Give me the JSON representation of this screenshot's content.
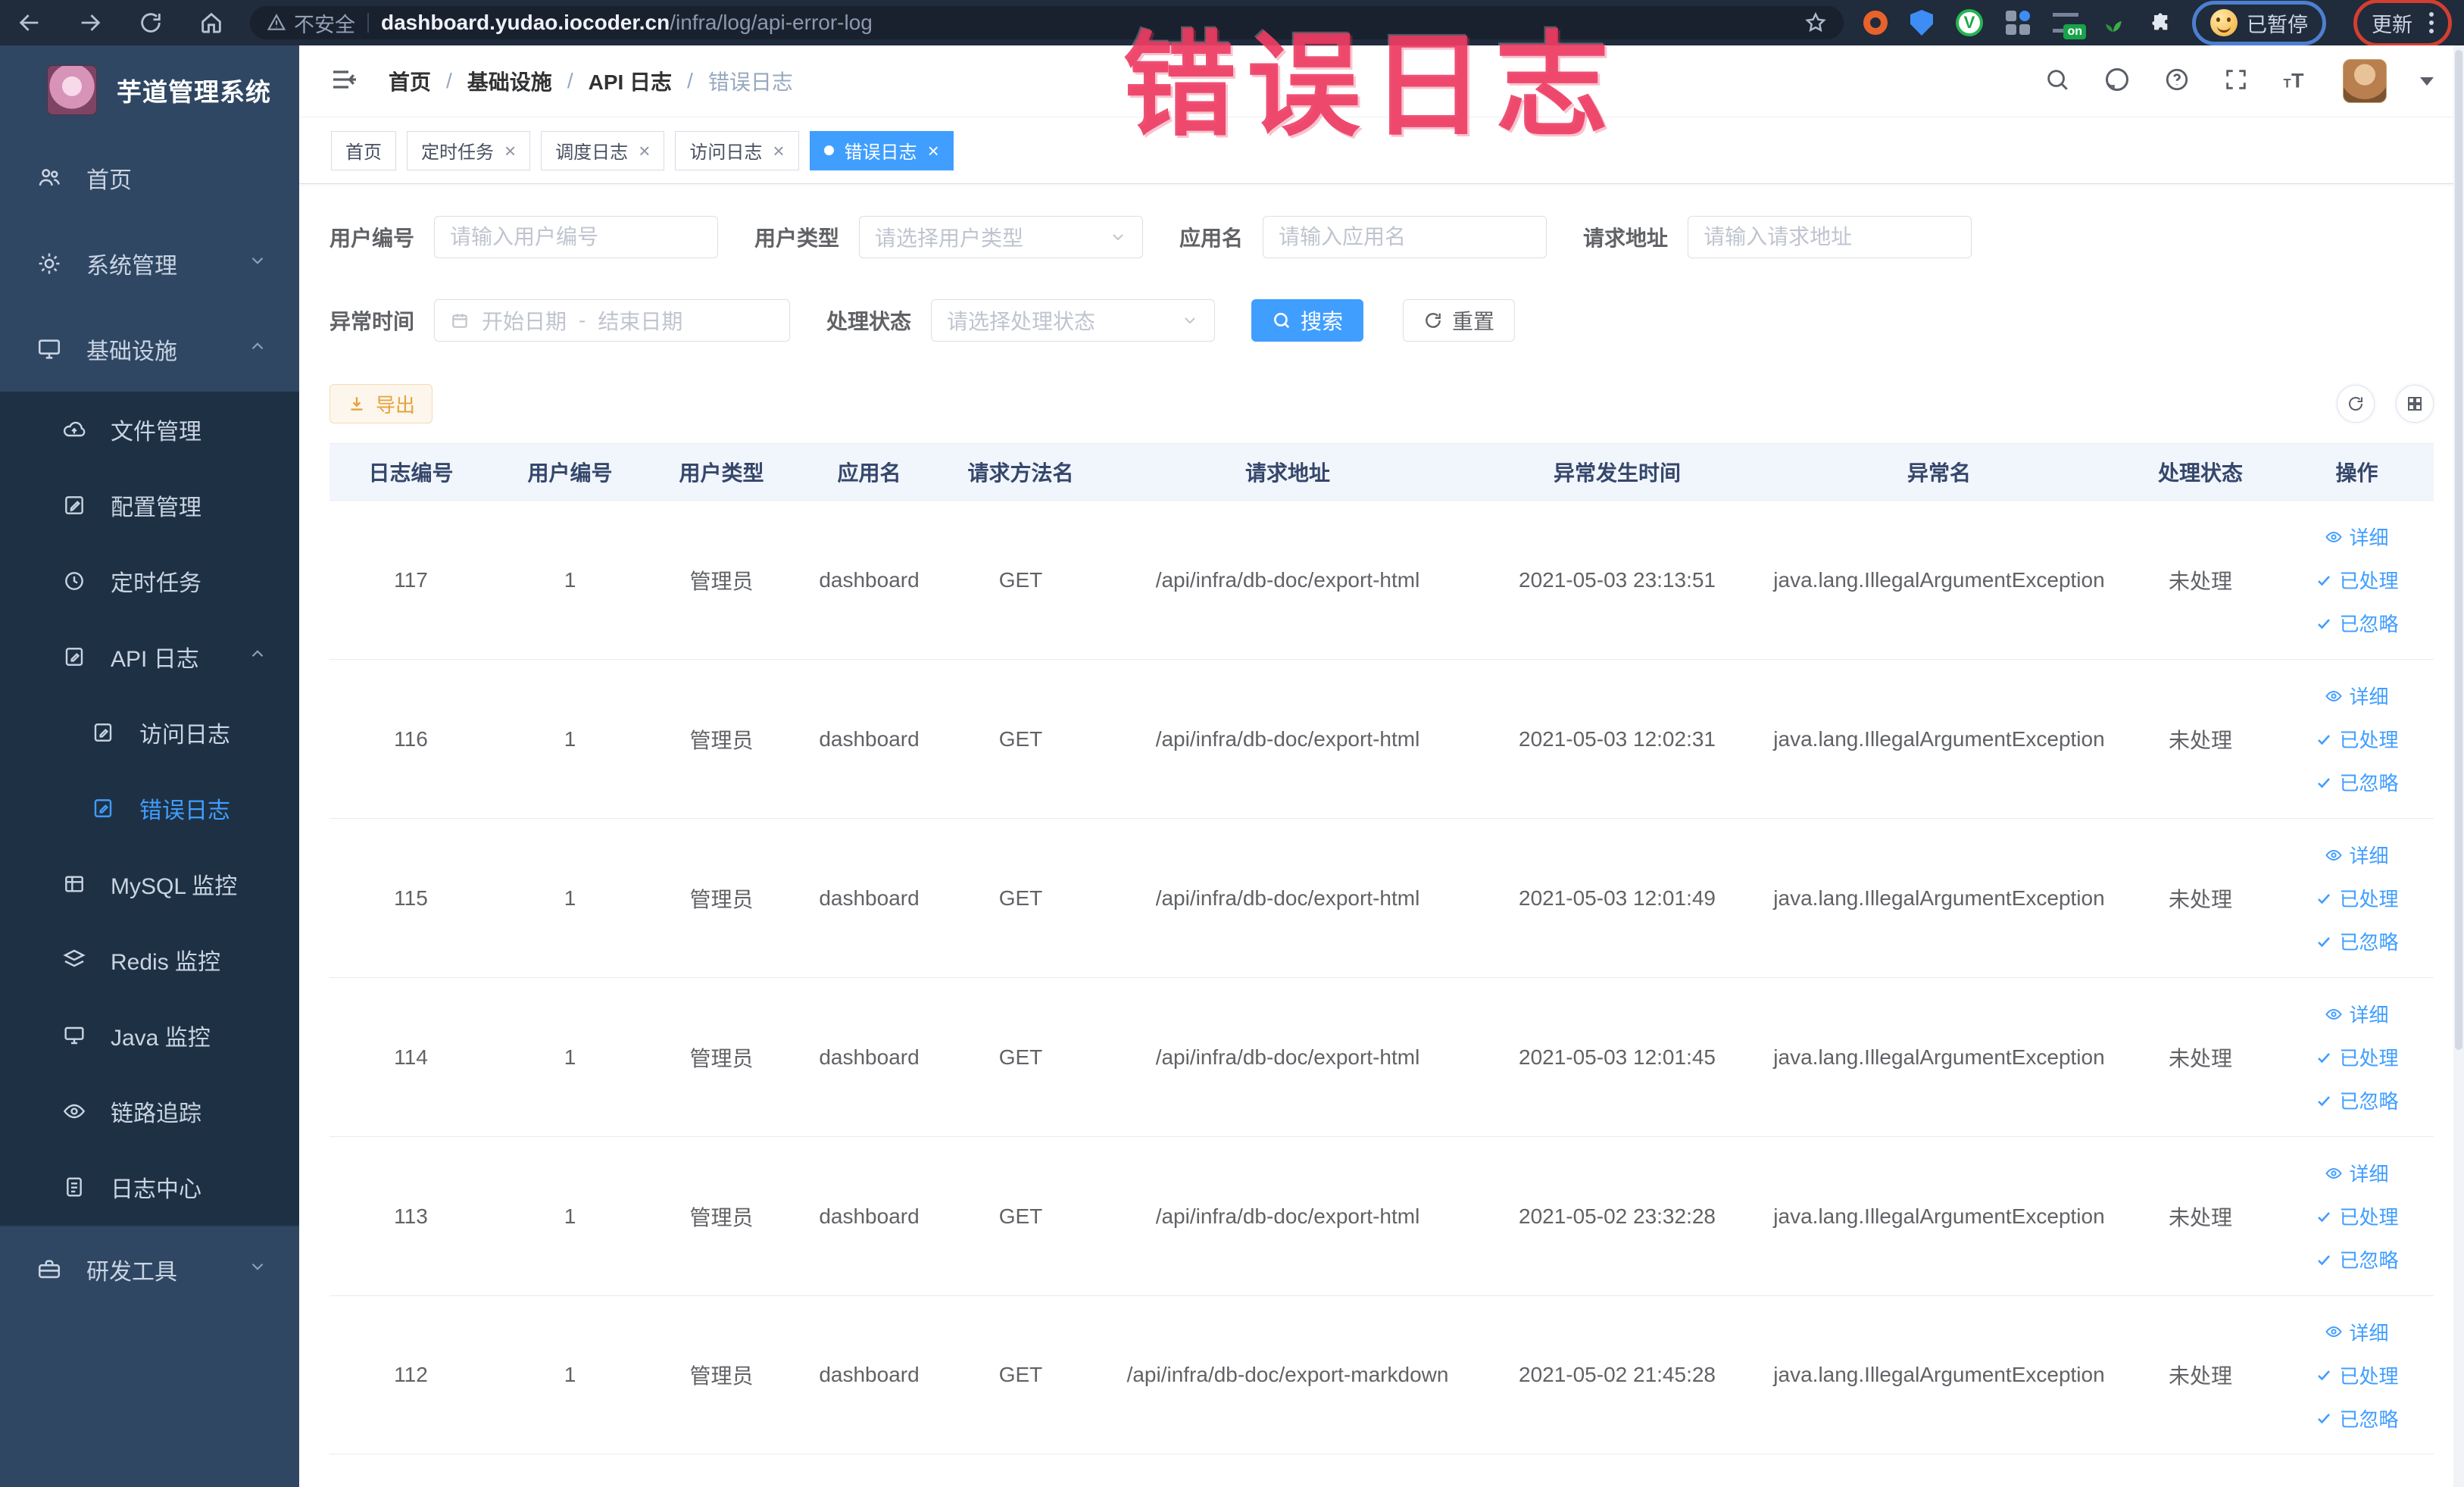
{
  "colors": {
    "primary": "#409eff",
    "warning": "#e6a23c",
    "annotation_pink": "#ec3860",
    "annotation_blue": "#4d7fd0",
    "annotation_red": "#d23f31",
    "sidebar_bg": "#2f4763",
    "submenu_bg": "#1e3144",
    "chrome_bg": "#202b3b"
  },
  "browser": {
    "security_label": "不安全",
    "url_host": "dashboard.yudao.iocoder.cn",
    "url_path": "/infra/log/api-error-log",
    "ext_v_label": "V",
    "on_badge": "on",
    "paused_chip": "已暂停",
    "update_label": "更新"
  },
  "annotation": {
    "title": "错误日志"
  },
  "sidebar": {
    "title": "芋道管理系统",
    "home": "首页",
    "system": "系统管理",
    "infra": "基础设施",
    "file": "文件管理",
    "config": "配置管理",
    "job": "定时任务",
    "api_log": "API 日志",
    "access_log": "访问日志",
    "error_log": "错误日志",
    "mysql": "MySQL 监控",
    "redis": "Redis 监控",
    "java": "Java 监控",
    "trace": "链路追踪",
    "log_center": "日志中心",
    "devtools": "研发工具"
  },
  "breadcrumb": {
    "items": [
      "首页",
      "基础设施",
      "API 日志",
      "错误日志"
    ],
    "separator": "/"
  },
  "tabs": [
    {
      "label": "首页"
    },
    {
      "label": "定时任务"
    },
    {
      "label": "调度日志"
    },
    {
      "label": "访问日志"
    },
    {
      "label": "错误日志"
    }
  ],
  "filters": {
    "user_id": {
      "label": "用户编号",
      "placeholder": "请输入用户编号"
    },
    "user_type": {
      "label": "用户类型",
      "placeholder": "请选择用户类型"
    },
    "app_name": {
      "label": "应用名",
      "placeholder": "请输入应用名"
    },
    "request_url": {
      "label": "请求地址",
      "placeholder": "请输入请求地址"
    },
    "exception_time": {
      "label": "异常时间",
      "start_placeholder": "开始日期",
      "separator": "-",
      "end_placeholder": "结束日期"
    },
    "process_status": {
      "label": "处理状态",
      "placeholder": "请选择处理状态"
    },
    "search": "搜索",
    "reset": "重置"
  },
  "toolbar": {
    "export": "导出"
  },
  "table": {
    "columns": [
      "日志编号",
      "用户编号",
      "用户类型",
      "应用名",
      "请求方法名",
      "请求地址",
      "异常发生时间",
      "异常名",
      "处理状态",
      "操作"
    ],
    "row_actions": [
      "详细",
      "已处理",
      "已忽略"
    ],
    "rows": [
      {
        "id": "117",
        "user_id": "1",
        "user_type": "管理员",
        "app": "dashboard",
        "method": "GET",
        "url": "/api/infra/db-doc/export-html",
        "time": "2021-05-03 23:13:51",
        "exception": "java.lang.IllegalArgumentException",
        "status": "未处理"
      },
      {
        "id": "116",
        "user_id": "1",
        "user_type": "管理员",
        "app": "dashboard",
        "method": "GET",
        "url": "/api/infra/db-doc/export-html",
        "time": "2021-05-03 12:02:31",
        "exception": "java.lang.IllegalArgumentException",
        "status": "未处理"
      },
      {
        "id": "115",
        "user_id": "1",
        "user_type": "管理员",
        "app": "dashboard",
        "method": "GET",
        "url": "/api/infra/db-doc/export-html",
        "time": "2021-05-03 12:01:49",
        "exception": "java.lang.IllegalArgumentException",
        "status": "未处理"
      },
      {
        "id": "114",
        "user_id": "1",
        "user_type": "管理员",
        "app": "dashboard",
        "method": "GET",
        "url": "/api/infra/db-doc/export-html",
        "time": "2021-05-03 12:01:45",
        "exception": "java.lang.IllegalArgumentException",
        "status": "未处理"
      },
      {
        "id": "113",
        "user_id": "1",
        "user_type": "管理员",
        "app": "dashboard",
        "method": "GET",
        "url": "/api/infra/db-doc/export-html",
        "time": "2021-05-02 23:32:28",
        "exception": "java.lang.IllegalArgumentException",
        "status": "未处理"
      },
      {
        "id": "112",
        "user_id": "1",
        "user_type": "管理员",
        "app": "dashboard",
        "method": "GET",
        "url": "/api/infra/db-doc/export-markdown",
        "time": "2021-05-02 21:45:28",
        "exception": "java.lang.IllegalArgumentException",
        "status": "未处理"
      }
    ]
  }
}
